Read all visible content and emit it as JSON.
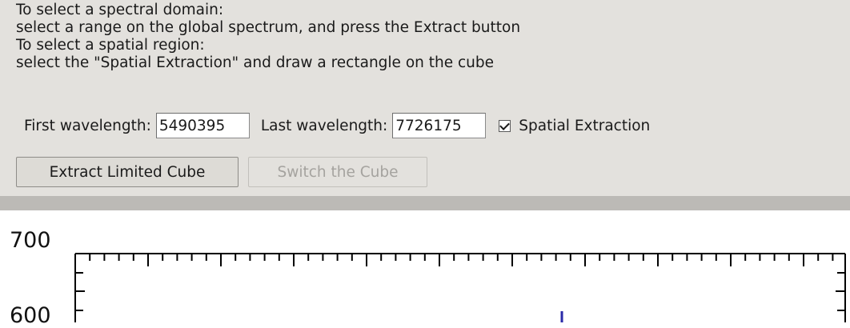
{
  "instructions": {
    "line1": "To select a spectral domain:",
    "line2": "select a range on the global spectrum, and press the Extract button",
    "line3": "To select a spatial region:",
    "line4": "select the \"Spatial Extraction\" and draw a rectangle on the cube"
  },
  "controls": {
    "first_label": "First wavelength:",
    "first_value": "5490395",
    "last_label": "Last wavelength:",
    "last_value": "7726175",
    "spatial_label": "Spatial Extraction",
    "spatial_checked": true
  },
  "buttons": {
    "extract": "Extract Limited Cube",
    "switch": "Switch the Cube"
  },
  "plot": {
    "y_ticks": [
      "700",
      "600"
    ],
    "frame_color": "#000000",
    "marker_color": "#2a2aa8"
  }
}
